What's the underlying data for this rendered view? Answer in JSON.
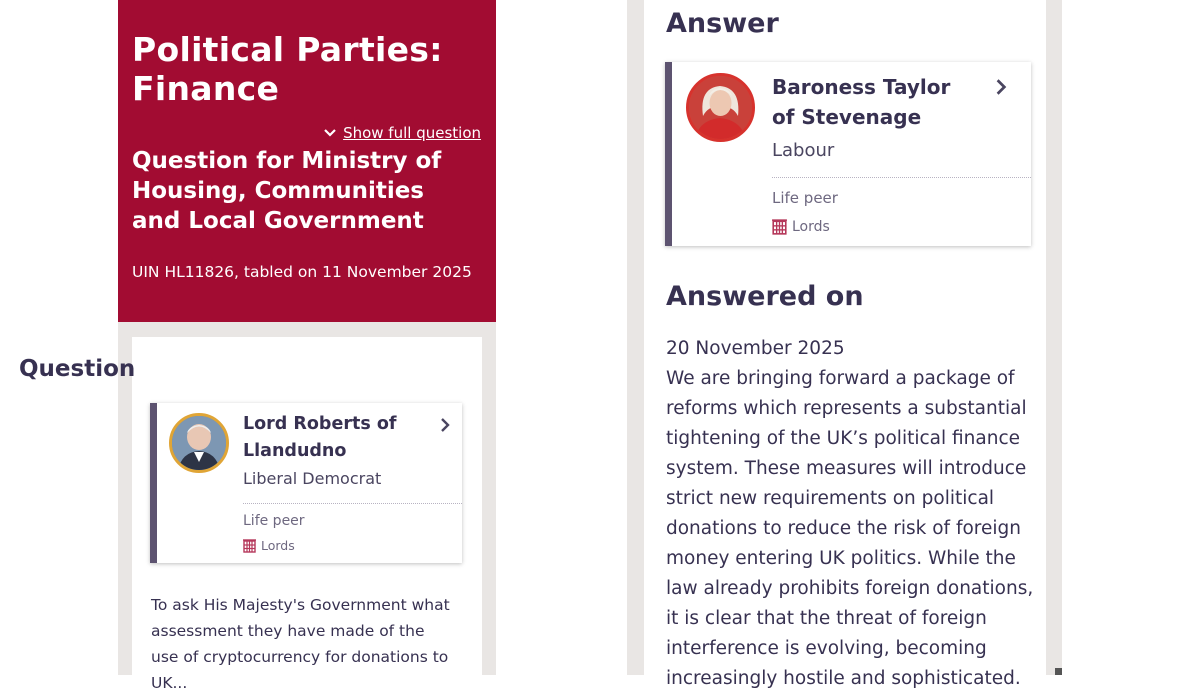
{
  "question_header": {
    "title": "Political Parties: Finance",
    "show_full_label": "Show full question",
    "department": "Question for Ministry of Housing, Communities and Local Government",
    "uin_line": "UIN HL11826, tabled on 11 November 2025"
  },
  "question_section": {
    "heading": "Question",
    "member": {
      "name": "Lord Roberts of Llandudno",
      "party": "Liberal Democrat",
      "peer_type": "Life peer",
      "house": "Lords"
    },
    "text": "To ask His Majesty's Government what assessment they have made of the use of cryptocurrency for donations to UK..."
  },
  "answer_section": {
    "heading": "Answer",
    "member": {
      "name": "Baroness Taylor of Stevenage",
      "party": "Labour",
      "peer_type": "Life peer",
      "house": "Lords"
    },
    "answered_heading": "Answered on",
    "answered_date": "20 November 2025",
    "text": "We are bringing forward a package of reforms which represents a substantial tightening of the UK’s political finance system. These measures will introduce strict new requirements on political donations to reduce the risk of foreign money entering UK politics. While the law already prohibits foreign donations, it is clear that the threat of foreign interference is evolving, becoming increasingly hostile and sophisticated."
  },
  "colors": {
    "header_red": "#a20c32",
    "party_bar": "#5d5370",
    "text_dark": "#373151",
    "lords_red": "#b5375a"
  },
  "icons": {
    "show_full": "chevron-down-icon",
    "member_link": "chevron-right-icon",
    "house": "portcullis-icon"
  }
}
